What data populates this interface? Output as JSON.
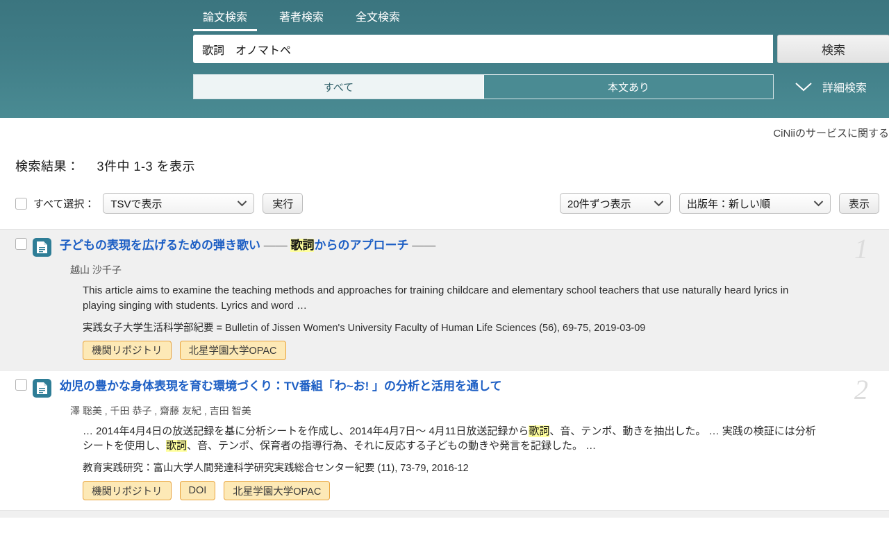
{
  "header": {
    "tabs": [
      {
        "label": "論文検索",
        "active": true
      },
      {
        "label": "著者検索",
        "active": false
      },
      {
        "label": "全文検索",
        "active": false
      }
    ],
    "search": {
      "value": "歌詞　オノマトペ",
      "placeholder": "",
      "button_label": "検索"
    },
    "segments": [
      {
        "label": "すべて",
        "active": false
      },
      {
        "label": "本文あり",
        "active": true
      }
    ],
    "advanced": {
      "label": "詳細検索",
      "icon": "chevron-down-icon"
    },
    "accent_color": "#4a8b93"
  },
  "notice": {
    "text": "CiNiiのサービスに関する"
  },
  "results_meta": {
    "count_label": "検索結果：",
    "count_text": "3件中 1-3 を表示",
    "select_all_label": "すべて選択：",
    "export_format": "TSVで表示",
    "execute_label": "実行",
    "per_page": "20件ずつ表示",
    "sort_order": "出版年：新しい順",
    "display_label": "表示"
  },
  "results": [
    {
      "index": "1",
      "shaded": true,
      "title_parts": [
        {
          "text": "子どもの表現を広げるための弾き歌い ",
          "style": "link"
        },
        {
          "text": "—— ",
          "style": "dash"
        },
        {
          "text": "歌詞",
          "style": "highlight"
        },
        {
          "text": "からのアプローチ ",
          "style": "link"
        },
        {
          "text": "——",
          "style": "dash"
        }
      ],
      "authors": "越山 沙千子",
      "abstract_parts": [
        {
          "text": "This article aims to examine the teaching methods and approaches for training childcare and elementary school teachers that use naturally heard lyrics in playing singing with students. Lyrics and word …",
          "style": "plain"
        }
      ],
      "journal": "実践女子大学生活科学部紀要 = Bulletin of Jissen Women's University Faculty of Human Life Sciences (56), 69-75, 2019-03-09",
      "badges": [
        "機関リポジトリ",
        "北星学園大学OPAC"
      ]
    },
    {
      "index": "2",
      "shaded": false,
      "title_parts": [
        {
          "text": "幼児の豊かな身体表現を育む環境づくり：TV番組「わ~お! 」の分析と活用を通して",
          "style": "link"
        }
      ],
      "authors": "澤 聡美 , 千田 恭子 , 齋藤 友紀 , 吉田 智美",
      "abstract_parts": [
        {
          "text": "… 2014年4月4日の放送記録を基に分析シートを作成し、2014年4月7日〜 4月11日放送記録から",
          "style": "plain"
        },
        {
          "text": "歌詞",
          "style": "highlight"
        },
        {
          "text": "、音、テンポ、動きを抽出した。 … 実践の検証には分析シートを使用し、",
          "style": "plain"
        },
        {
          "text": "歌詞",
          "style": "highlight"
        },
        {
          "text": "、音、テンポ、保育者の指導行為、それに反応する子どもの動きや発言を記録した。 …",
          "style": "plain"
        }
      ],
      "journal": "教育実践研究：富山大学人間発達科学研究実践総合センター紀要 (11), 73-79, 2016-12",
      "badges": [
        "機関リポジトリ",
        "DOI",
        "北星学園大学OPAC"
      ]
    }
  ],
  "icons": {
    "document": "document-icon",
    "chevron_down": "chevron-down-icon",
    "caret_down": "caret-down-icon"
  }
}
